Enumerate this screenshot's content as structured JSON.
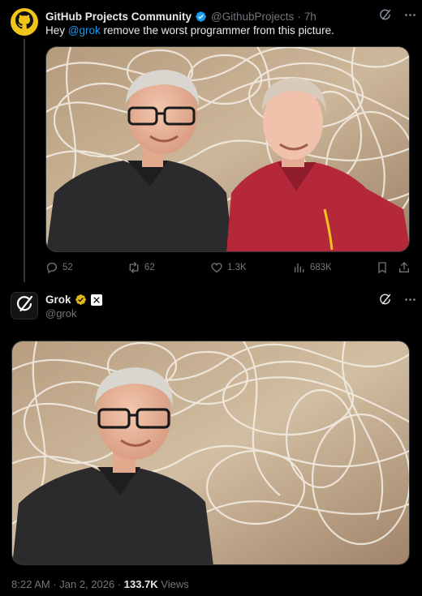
{
  "post": {
    "author_name": "GitHub Projects Community",
    "author_handle": "@GithubProjects",
    "separator": "·",
    "time": "7h",
    "text_prefix": "Hey ",
    "mention": "@grok",
    "text_suffix": " remove the worst programmer from this picture.",
    "stats": {
      "replies": "52",
      "reposts": "62",
      "likes": "1.3K",
      "views": "683K"
    }
  },
  "reply": {
    "author_name": "Grok",
    "author_handle": "@grok",
    "timestamp": "8:22 AM · Jan 2, 2026 · ",
    "views_count": "133.7K",
    "views_label": " Views"
  },
  "colors": {
    "background": "#000000",
    "text": "#e7e9ea",
    "muted": "#71767b",
    "accent": "#1d9bf0",
    "gold_badge": "#e2b719",
    "avatar_github": "#f0c419"
  },
  "icons": {
    "post_avatar": "github-octocat-icon",
    "reply_avatar": "grok-logo-icon",
    "verified": "verified-badge-icon",
    "grok_action": "grok-icon",
    "more": "more-icon",
    "reply": "reply-icon",
    "repost": "repost-icon",
    "like": "like-icon",
    "views": "views-icon",
    "bookmark": "bookmark-icon",
    "share": "share-icon"
  }
}
